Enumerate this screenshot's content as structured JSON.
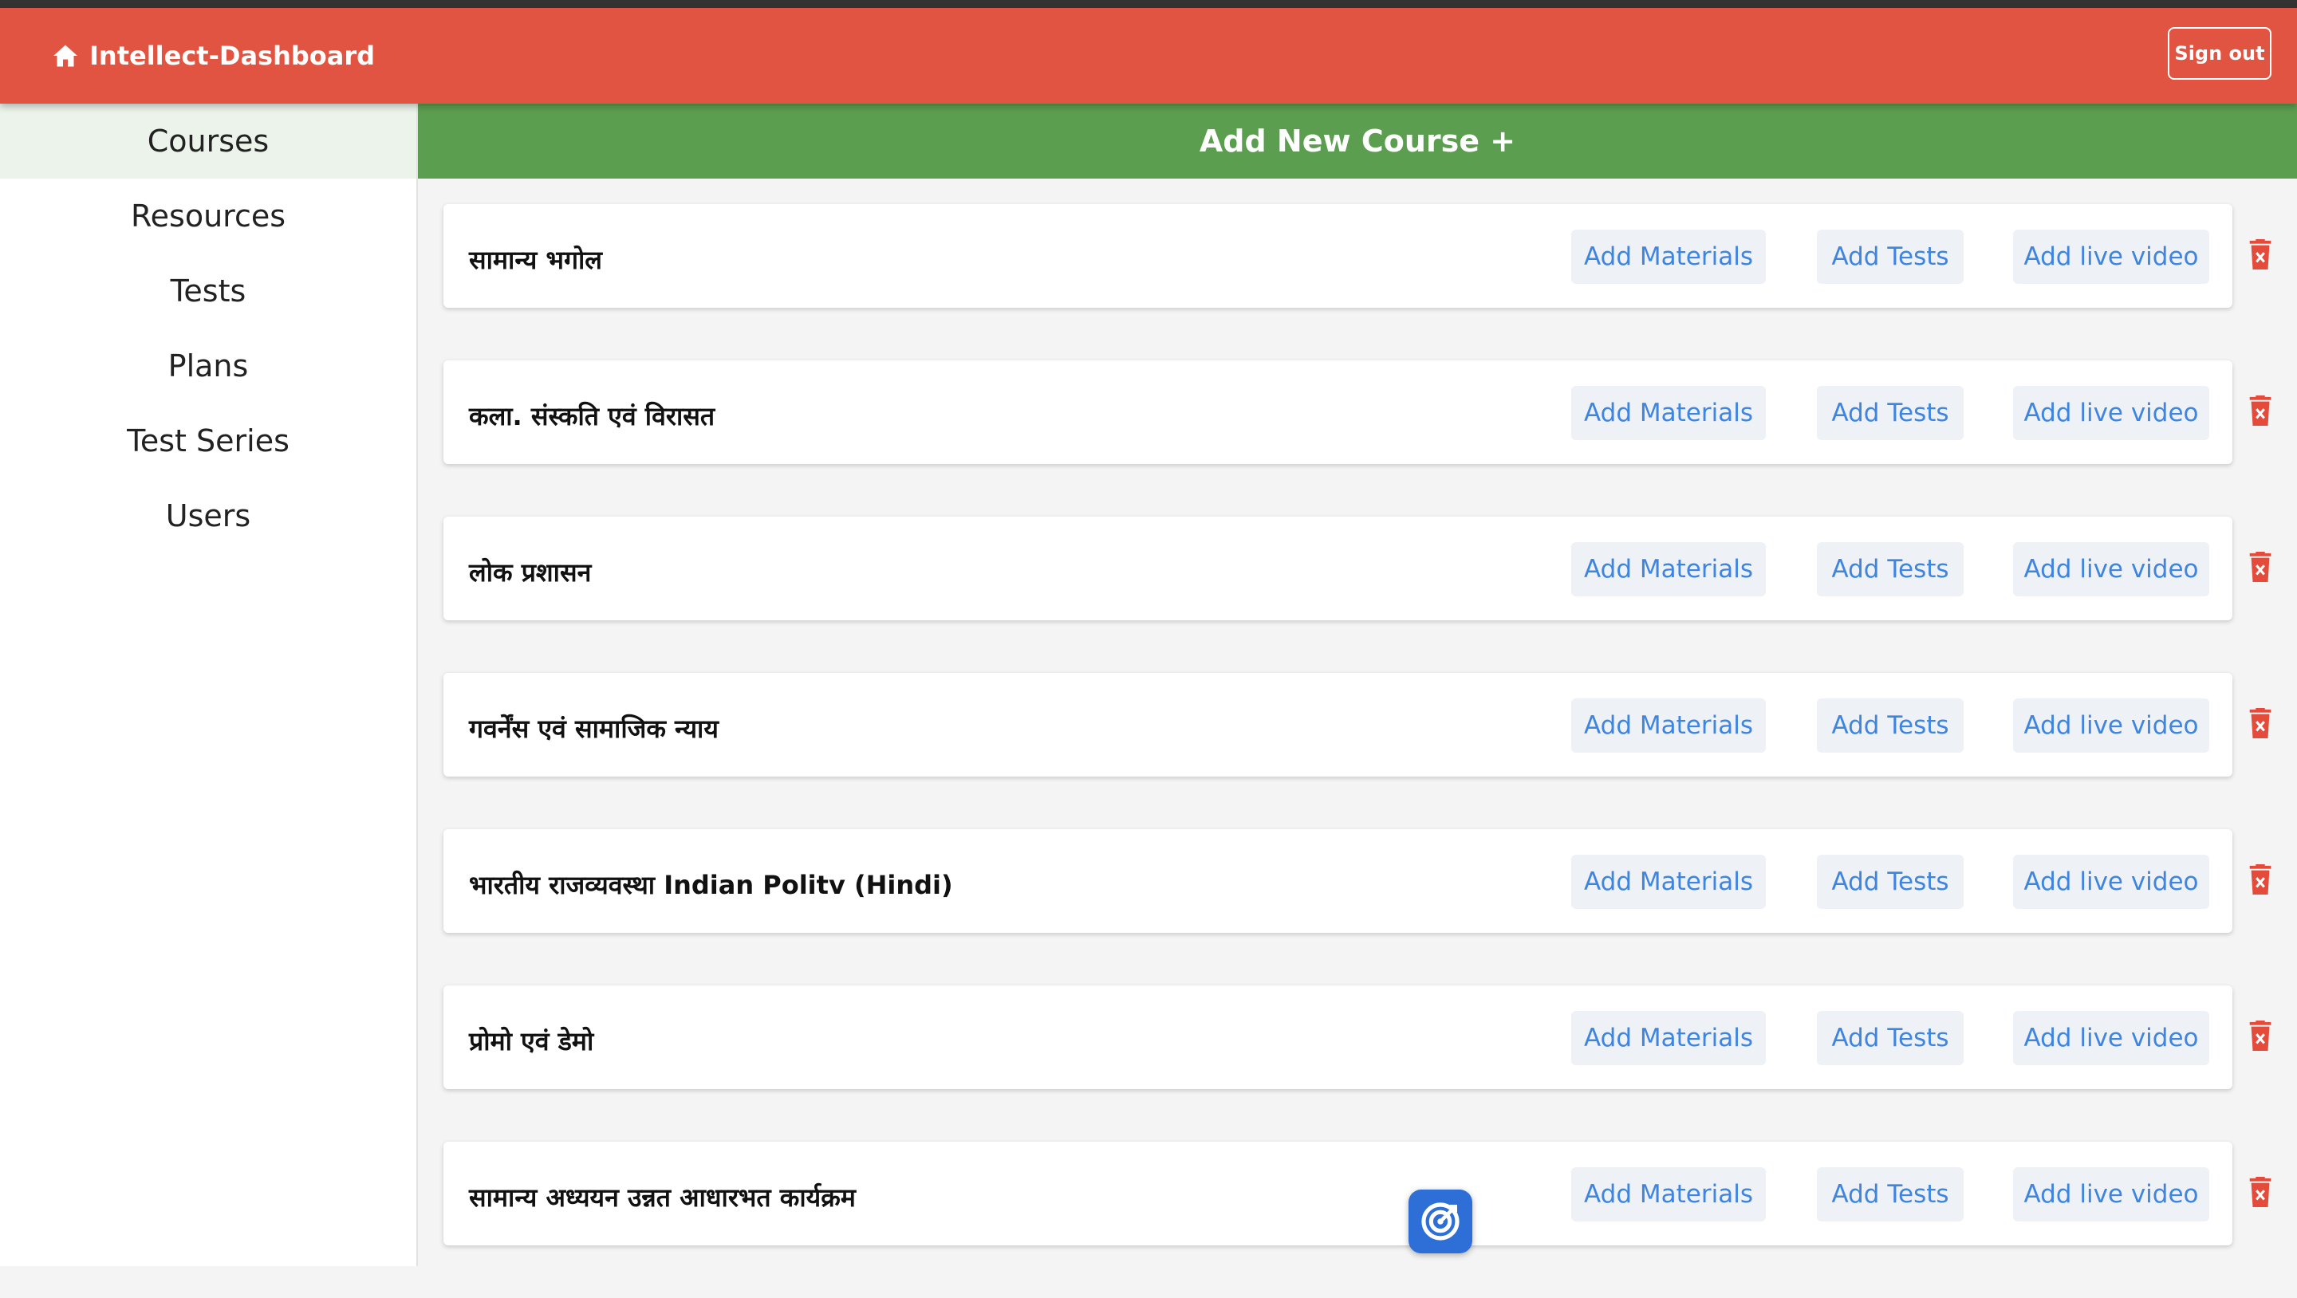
{
  "header": {
    "brand": "Intellect-Dashboard",
    "home_icon": "home-icon",
    "sign_out": "Sign out",
    "color": "#e15441"
  },
  "sidebar": {
    "items": [
      {
        "label": "Courses",
        "active": true
      },
      {
        "label": "Resources"
      },
      {
        "label": "Tests"
      },
      {
        "label": "Plans"
      },
      {
        "label": "Test Series"
      },
      {
        "label": "Users"
      }
    ]
  },
  "add_course": {
    "label": "Add New Course +",
    "color": "#5c9e50"
  },
  "actions": {
    "materials": "Add Materials",
    "tests": "Add Tests",
    "live_video": "Add live video",
    "delete_icon": "trash-icon"
  },
  "courses": [
    {
      "title": "सामान्य भगोल"
    },
    {
      "title": "कला. संस्कति एवं विरासत"
    },
    {
      "title": "लोक प्रशासन"
    },
    {
      "title": "गवर्नेंस एवं सामाजिक न्याय"
    },
    {
      "title": "भारतीय राजव्यवस्था Indian Politv (Hindi)"
    },
    {
      "title": "प्रोमो एवं डेमो"
    },
    {
      "title": "सामान्य अध्ययन   उन्नत आधारभत कार्यक्रम"
    }
  ],
  "floating_button": {
    "icon": "target-icon"
  }
}
